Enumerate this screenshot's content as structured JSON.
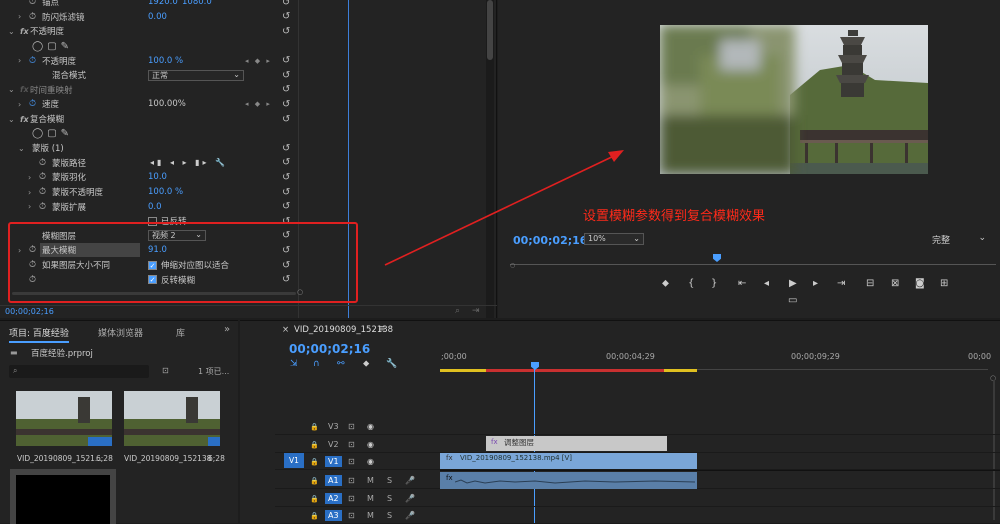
{
  "effects": {
    "rows": [
      {
        "label": "锚点",
        "values": [
          "1920.0",
          "1080.0"
        ],
        "indent": 42,
        "stopwatch": true,
        "chev": false
      },
      {
        "label": "防闪烁滤镜",
        "value": "0.00",
        "indent": 42,
        "stopwatch": true,
        "chev": true
      },
      {
        "label": "不透明度",
        "fx": true,
        "indent": 30,
        "header": true
      },
      {
        "label": "",
        "shapes": true,
        "indent": 30
      },
      {
        "label": "不透明度",
        "value": "100.0 %",
        "indent": 42,
        "stopwatch": true,
        "active": true,
        "chev": true,
        "kf": "◂ ◆ ▸"
      },
      {
        "label": "混合模式",
        "select": "正常",
        "indent": 52
      },
      {
        "label": "时间重映射",
        "fx": true,
        "indent": 30,
        "header": true,
        "dim": true
      },
      {
        "label": "速度",
        "value": "100.00%",
        "white": true,
        "indent": 42,
        "stopwatch": true,
        "active": true,
        "chev": true,
        "kf": "◂ ◆ ▸"
      },
      {
        "label": "复合模糊",
        "fx": true,
        "indent": 30,
        "header": true
      },
      {
        "label": "",
        "shapes": true,
        "indent": 30
      },
      {
        "label": "蒙版 (1)",
        "indent": 32,
        "chevdown": true
      },
      {
        "label": "蒙版路径",
        "indent": 52,
        "stopwatch": true,
        "maskctl": "◂▮ ◂ ▸ ▮▸ 🔧"
      },
      {
        "label": "蒙版羽化",
        "value": "10.0",
        "indent": 52,
        "stopwatch": true,
        "chev": true
      },
      {
        "label": "蒙版不透明度",
        "value": "100.0 %",
        "indent": 52,
        "stopwatch": true,
        "chev": true
      },
      {
        "label": "蒙版扩展",
        "value": "0.0",
        "indent": 52,
        "stopwatch": true,
        "chev": true
      },
      {
        "label": "",
        "checkbox": "已反转",
        "checked": false,
        "indent": 148
      },
      {
        "label": "模糊图层",
        "select": "视频 2",
        "indent": 42
      },
      {
        "label": "最大模糊",
        "value": "91.0",
        "indent": 42,
        "stopwatch": true,
        "chev": true,
        "selected": true
      },
      {
        "label": "如果图层大小不同",
        "checkbox": "伸缩对应图以适合",
        "checked": true,
        "indent": 42,
        "stopwatch": true
      },
      {
        "label": "",
        "checkbox": "反转模糊",
        "checked": true,
        "indent": 42,
        "stopwatch": true
      }
    ],
    "timecode": "00;00;02;16"
  },
  "monitor": {
    "timecode": "00;00;02;16",
    "zoom": "10%",
    "quality": "完整"
  },
  "annotation": "设置模糊参数得到复合模糊效果",
  "project": {
    "tabs": [
      "项目: 百度经验",
      "媒体浏览器",
      "库"
    ],
    "file": "百度经验.prproj",
    "count": "1 项已...",
    "clips": [
      {
        "name": "VID_20190809_1521...",
        "dur": "6;28"
      },
      {
        "name": "VID_20190809_152138",
        "dur": "6;28"
      }
    ]
  },
  "timeline": {
    "tab": "VID_20190809_152138",
    "timecode": "00;00;02;16",
    "ruler": [
      ";00;00",
      "00;00;04;29",
      "00;00;09;29",
      "00;00"
    ],
    "adjust_label": "调整图层",
    "clip_label": "VID_20190809_152138.mp4 [V]",
    "tracks": [
      "V3",
      "V2",
      "V1",
      "A1",
      "A2",
      "A3"
    ],
    "src_v": "V1"
  }
}
